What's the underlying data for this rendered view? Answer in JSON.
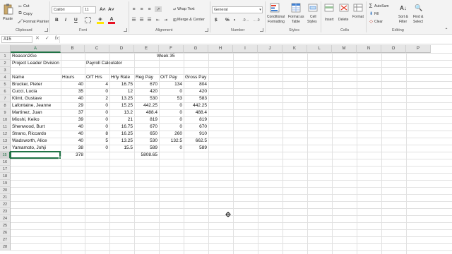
{
  "ribbon": {
    "clipboard": {
      "paste": "Paste",
      "cut": "Cut",
      "copy": "Copy",
      "format_painter": "Format Painter",
      "group": "Clipboard"
    },
    "font": {
      "name": "Calibri",
      "size": "11",
      "grow": "A˄",
      "shrink": "A˅",
      "bold": "B",
      "italic": "I",
      "underline": "U",
      "group": "Font"
    },
    "alignment": {
      "wrap": "Wrap Text",
      "merge": "Merge & Center",
      "group": "Alignment"
    },
    "number": {
      "format": "General",
      "currency": "$",
      "percent": "%",
      "comma": "•",
      "group": "Number"
    },
    "styles": {
      "conditional": "Conditional",
      "conditional2": "Formatting",
      "format_table": "Format as",
      "format_table2": "Table",
      "cell_styles": "Cell",
      "cell_styles2": "Styles",
      "group": "Styles"
    },
    "cells": {
      "insert": "Insert",
      "delete": "Delete",
      "format": "Format",
      "group": "Cells"
    },
    "editing": {
      "autosum": "AutoSum",
      "fill": "Fill",
      "clear": "Clear",
      "sort": "Sort &",
      "sort2": "Filter",
      "find": "Find &",
      "find2": "Select",
      "group": "Editing"
    }
  },
  "formula_bar": {
    "name_box": "A15",
    "cancel": "✕",
    "enter": "✓",
    "fx": "fx",
    "content": ""
  },
  "columns": [
    "A",
    "B",
    "C",
    "D",
    "E",
    "F",
    "G",
    "H",
    "I",
    "J",
    "K",
    "L",
    "M",
    "N",
    "O",
    "P"
  ],
  "rows": [
    "1",
    "2",
    "3",
    "4",
    "5",
    "6",
    "7",
    "8",
    "9",
    "10",
    "11",
    "12",
    "13",
    "14",
    "15",
    "16",
    "17",
    "18",
    "19",
    "20",
    "21",
    "22",
    "23",
    "24",
    "25",
    "26",
    "27",
    "28"
  ],
  "sheet": {
    "title": "Reason2Go",
    "week": "Week 35",
    "division": "Project Leader Division",
    "calculator": "Payroll Calculator",
    "headers": [
      "Name",
      "Hours",
      "O/T Hrs",
      "Hrly Rate",
      "Reg Pay",
      "O/T Pay",
      "Gross Pay"
    ],
    "employees": [
      [
        "Brucker, Pieter",
        "40",
        "4",
        "16.75",
        "670",
        "134",
        "804"
      ],
      [
        "Cucci, Lucia",
        "35",
        "0",
        "12",
        "420",
        "0",
        "420"
      ],
      [
        "Klimt, Gustave",
        "40",
        "2",
        "13.25",
        "530",
        "53",
        "583"
      ],
      [
        "Lafontaine, Jeanne",
        "29",
        "0",
        "15.25",
        "442.25",
        "0",
        "442.25"
      ],
      [
        "Martinez, Juan",
        "37",
        "0",
        "13.2",
        "488.4",
        "0",
        "488.4"
      ],
      [
        "Mioshi, Keiko",
        "39",
        "0",
        "21",
        "819",
        "0",
        "819"
      ],
      [
        "Shenwood, Burt",
        "40",
        "0",
        "16.75",
        "670",
        "0",
        "670"
      ],
      [
        "Strano, Riccardo",
        "40",
        "8",
        "16.25",
        "650",
        "260",
        "910"
      ],
      [
        "Wadsworth, Alice",
        "40",
        "5",
        "13.25",
        "530",
        "132.5",
        "662.5"
      ],
      [
        "Yamamoto, Johji",
        "38",
        "0",
        "15.5",
        "589",
        "0",
        "589"
      ]
    ],
    "total_hours": "378",
    "total_reg_pay": "5808.65"
  }
}
